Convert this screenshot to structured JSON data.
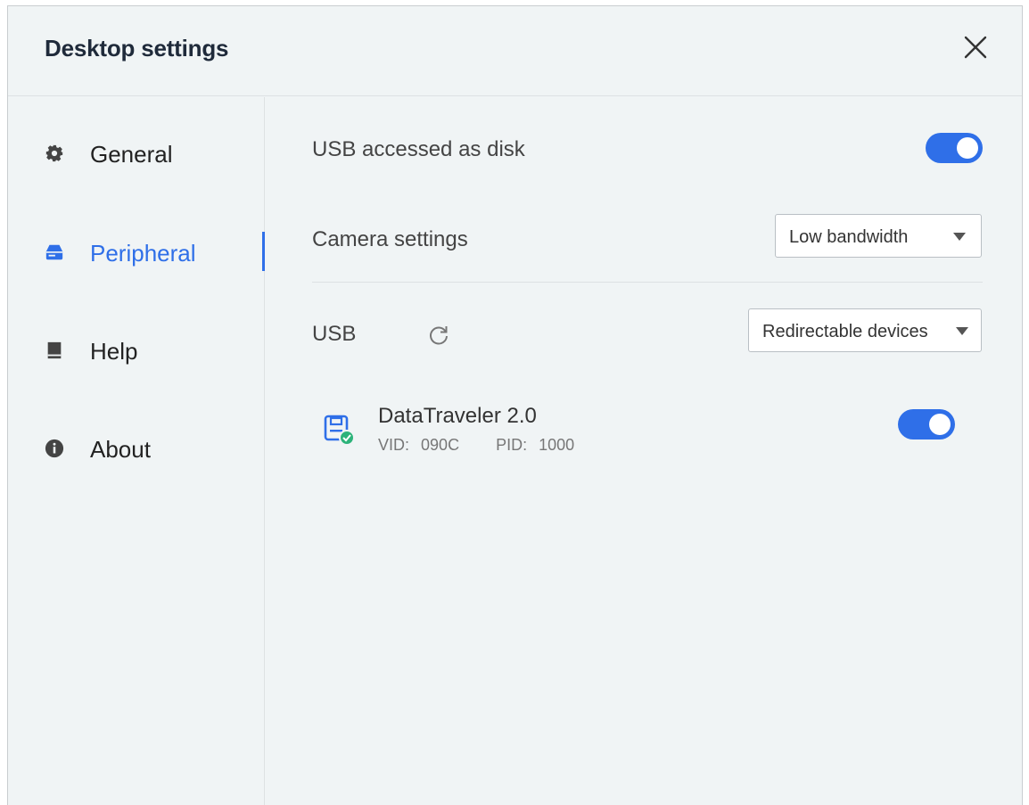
{
  "window": {
    "title": "Desktop settings"
  },
  "sidebar": {
    "items": [
      {
        "label": "General",
        "icon": "gear-icon",
        "active": false
      },
      {
        "label": "Peripheral",
        "icon": "peripheral-icon",
        "active": true
      },
      {
        "label": "Help",
        "icon": "book-icon",
        "active": false
      },
      {
        "label": "About",
        "icon": "info-icon",
        "active": false
      }
    ]
  },
  "settings": {
    "usb_disk": {
      "label": "USB accessed as disk",
      "enabled": true
    },
    "camera": {
      "label": "Camera settings",
      "selected": "Low bandwidth"
    },
    "usb": {
      "label": "USB",
      "filter_selected": "Redirectable devices"
    }
  },
  "devices": [
    {
      "name": "DataTraveler 2.0",
      "vid_label": "VID:",
      "vid": "090C",
      "pid_label": "PID:",
      "pid": "1000",
      "enabled": true,
      "icon": "usb-drive-icon"
    }
  ],
  "colors": {
    "accent": "#2f6fe8",
    "background": "#f0f4f5",
    "success": "#2db37a"
  }
}
